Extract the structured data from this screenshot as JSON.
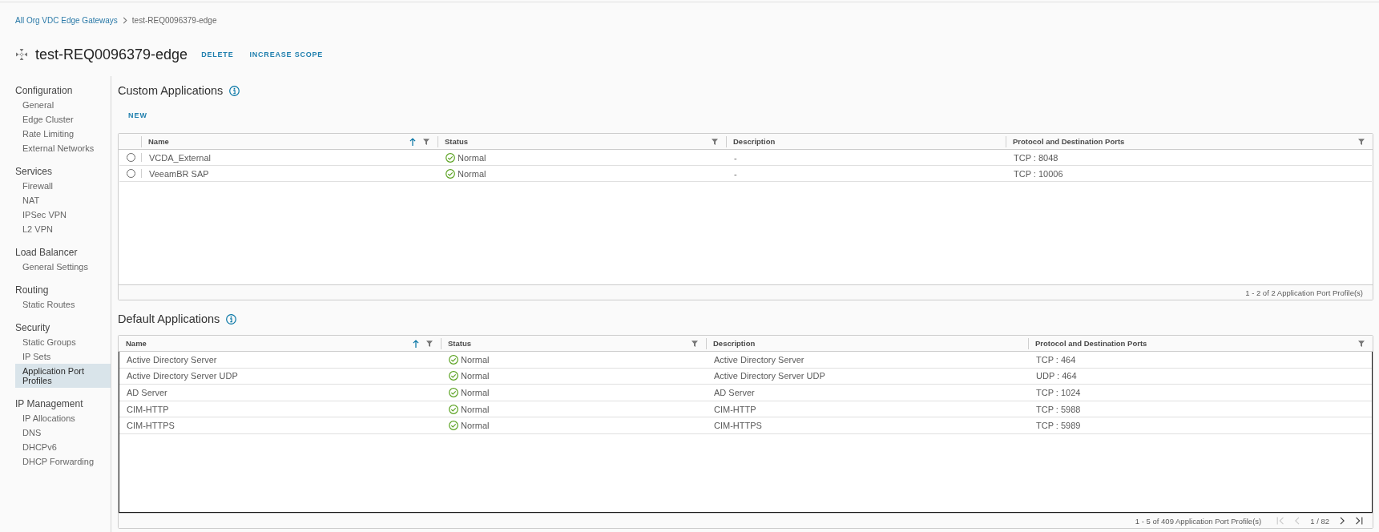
{
  "breadcrumb": {
    "link": "All Org VDC Edge Gateways",
    "current": "test-REQ0096379-edge"
  },
  "header": {
    "title": "test-REQ0096379-edge",
    "actions": [
      "DELETE",
      "INCREASE SCOPE"
    ]
  },
  "sidebar": {
    "sections": [
      {
        "title": "Configuration",
        "items": [
          {
            "label": "General",
            "selected": false
          },
          {
            "label": "Edge Cluster",
            "selected": false
          },
          {
            "label": "Rate Limiting",
            "selected": false
          },
          {
            "label": "External Networks",
            "selected": false
          }
        ]
      },
      {
        "title": "Services",
        "items": [
          {
            "label": "Firewall",
            "selected": false
          },
          {
            "label": "NAT",
            "selected": false
          },
          {
            "label": "IPSec VPN",
            "selected": false
          },
          {
            "label": "L2 VPN",
            "selected": false
          }
        ]
      },
      {
        "title": "Load Balancer",
        "items": [
          {
            "label": "General Settings",
            "selected": false
          }
        ]
      },
      {
        "title": "Routing",
        "items": [
          {
            "label": "Static Routes",
            "selected": false
          }
        ]
      },
      {
        "title": "Security",
        "items": [
          {
            "label": "Static Groups",
            "selected": false
          },
          {
            "label": "IP Sets",
            "selected": false
          },
          {
            "label": "Application Port Profiles",
            "selected": true
          }
        ]
      },
      {
        "title": "IP Management",
        "items": [
          {
            "label": "IP Allocations",
            "selected": false
          },
          {
            "label": "DNS",
            "selected": false
          },
          {
            "label": "DHCPv6",
            "selected": false
          },
          {
            "label": "DHCP Forwarding",
            "selected": false
          }
        ]
      }
    ]
  },
  "custom_applications": {
    "title": "Custom Applications",
    "actions": [
      "NEW"
    ],
    "table": {
      "focused": false,
      "columns": [
        {
          "label": "Name",
          "sorted": true,
          "filter": true
        },
        {
          "label": "Status",
          "sorted": false,
          "filter": true
        },
        {
          "label": "Description",
          "sorted": false,
          "filter": false
        },
        {
          "label": "Protocol and Destination Ports",
          "sorted": false,
          "filter": true
        }
      ],
      "rows": [
        {
          "selected": false,
          "name": "VCDA_External",
          "status": {
            "kind": "normal",
            "label": "Normal"
          },
          "description": "-",
          "ports": "TCP : 8048"
        },
        {
          "selected": false,
          "name": "VeeamBR SAP",
          "status": {
            "kind": "normal",
            "label": "Normal"
          },
          "description": "-",
          "ports": "TCP : 10006"
        }
      ],
      "footer": "1 - 2 of 2 Application Port Profile(s)"
    }
  },
  "default_applications": {
    "title": "Default Applications",
    "table": {
      "focused": true,
      "columns": [
        {
          "label": "Name",
          "sorted": true,
          "filter": true
        },
        {
          "label": "Status",
          "sorted": false,
          "filter": true
        },
        {
          "label": "Description",
          "sorted": false,
          "filter": false
        },
        {
          "label": "Protocol and Destination Ports",
          "sorted": false,
          "filter": true
        }
      ],
      "rows": [
        {
          "name": "Active Directory Server",
          "status": {
            "kind": "normal",
            "label": "Normal"
          },
          "description": "Active Directory Server",
          "ports": "TCP : 464"
        },
        {
          "name": "Active Directory Server UDP",
          "status": {
            "kind": "normal",
            "label": "Normal"
          },
          "description": "Active Directory Server UDP",
          "ports": "UDP : 464"
        },
        {
          "name": "AD Server",
          "status": {
            "kind": "normal",
            "label": "Normal"
          },
          "description": "AD Server",
          "ports": "TCP : 1024"
        },
        {
          "name": "CIM-HTTP",
          "status": {
            "kind": "normal",
            "label": "Normal"
          },
          "description": "CIM-HTTP",
          "ports": "TCP : 5988"
        },
        {
          "name": "CIM-HTTPS",
          "status": {
            "kind": "normal",
            "label": "Normal"
          },
          "description": "CIM-HTTPS",
          "ports": "TCP : 5989"
        }
      ],
      "footer": "1 - 5 of 409 Application Port Profile(s)",
      "pagination": {
        "controls": [
          {
            "kind": "first",
            "disabled": true
          },
          {
            "kind": "previous",
            "disabled": true
          },
          {
            "kind": "page",
            "label": "1 / 82"
          },
          {
            "kind": "next",
            "disabled": false
          },
          {
            "kind": "last",
            "disabled": false
          }
        ]
      }
    }
  }
}
